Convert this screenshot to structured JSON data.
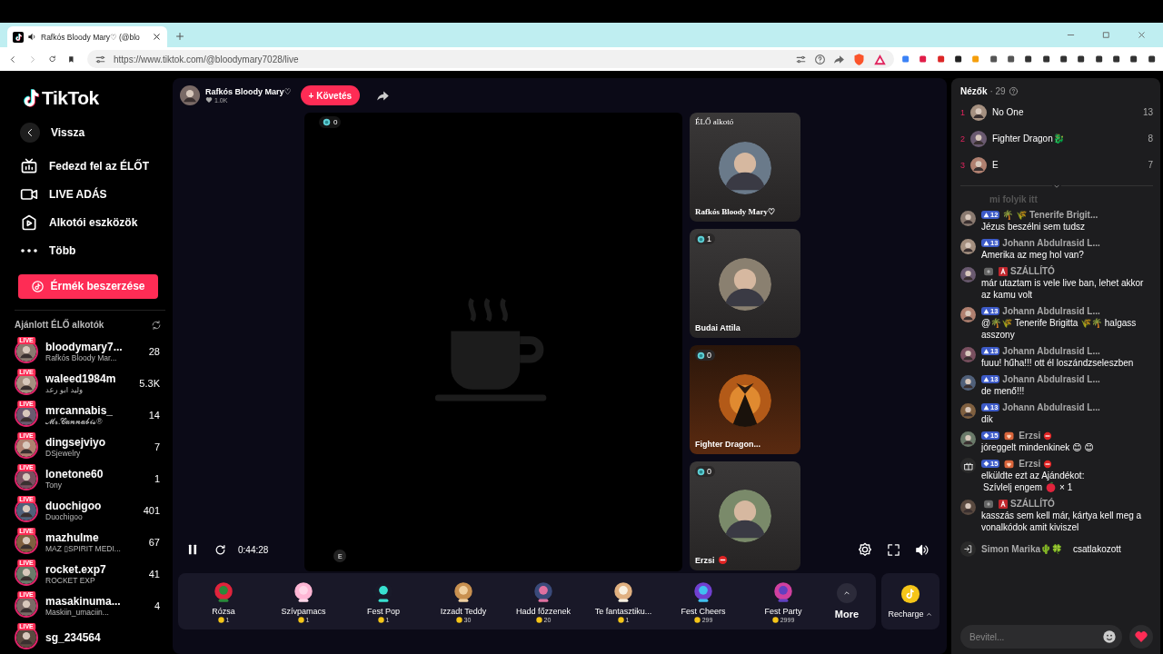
{
  "browser": {
    "tab": {
      "title": "Rafkós Bloody Mary♡ (@blo"
    },
    "url": "https://www.tiktok.com/@bloodymary7028/live"
  },
  "sidebar": {
    "logo": "TikTok",
    "back": "Vissza",
    "nav": [
      {
        "label": "Fedezd fel az ÉLŐT",
        "kind": "tv"
      },
      {
        "label": "LIVE ADÁS",
        "kind": "camera"
      },
      {
        "label": "Alkotói eszközök",
        "kind": "play"
      },
      {
        "label": "Több",
        "kind": "more"
      }
    ],
    "coins_button": "Érmék beszerzése",
    "suggested_title": "Ajánlott ÉLŐ alkotók",
    "creators": [
      {
        "username": "bloodymary7...",
        "name": "Rafkós Bloody Mar...",
        "viewers": "28",
        "badge": "LIVE"
      },
      {
        "username": "waleed1984m",
        "name": "وليد ابو رعد",
        "viewers": "5.3K",
        "badge": "LIVE"
      },
      {
        "username": "mrcannabis_",
        "name": "𝓜𝓻.𝓒𝓪𝓷𝓷𝓪𝓫𝓲𝓼®",
        "viewers": "14",
        "badge": "LIVE"
      },
      {
        "username": "dingsejviyo",
        "name": "DSjewelry",
        "viewers": "7",
        "badge": "LIVE"
      },
      {
        "username": "lonetone60",
        "name": "Tony",
        "viewers": "1",
        "badge": "LIVE"
      },
      {
        "username": "duochigoo",
        "name": "Duochigoo",
        "viewers": "401",
        "badge": "LIVE"
      },
      {
        "username": "mazhulme",
        "name": "MAZ ▯SPIRIT MEDI...",
        "viewers": "67",
        "badge": "LIVE"
      },
      {
        "username": "rocket.exp7",
        "name": "ROCKET EXP",
        "viewers": "41",
        "badge": "LIVE"
      },
      {
        "username": "masakinuma...",
        "name": "Maskiin_umaciin...",
        "viewers": "4",
        "badge": "LIVE"
      },
      {
        "username": "sg_234564",
        "badge": "LIVE"
      }
    ]
  },
  "stream": {
    "host": {
      "name": "Rafkós Bloody Mary♡",
      "likes": "1.0K"
    },
    "follow": "+ Követés",
    "main_viewers": "0",
    "guests": [
      {
        "label": "ÉLŐ alkotó",
        "name": "Rafkós Bloody Mary♡",
        "kind": "host",
        "blocked": false
      },
      {
        "count": "1",
        "name": "Budai Attila",
        "kind": "guest",
        "blocked": false
      },
      {
        "count": "0",
        "name": "Fighter Dragon...",
        "kind": "dragon",
        "blocked": false
      },
      {
        "count": "0",
        "name": "Erzsi",
        "kind": "guest",
        "blocked": true
      }
    ],
    "paused": false,
    "time": "0:44:28",
    "corner_badge": "E"
  },
  "gifts": [
    {
      "name": "Rózsa",
      "price": "1"
    },
    {
      "name": "Szívpamacs",
      "price": "1"
    },
    {
      "name": "Fest Pop",
      "price": "1"
    },
    {
      "name": "Izzadt Teddy",
      "price": "30"
    },
    {
      "name": "Hadd főzzenek",
      "price": "20"
    },
    {
      "name": "Te fantasztiku...",
      "price": "1"
    },
    {
      "name": "Fest Cheers",
      "price": "299"
    },
    {
      "name": "Fest Party",
      "price": "2999"
    }
  ],
  "more": "More",
  "recharge": "Recharge",
  "viewers": {
    "title": "Nézők",
    "count": "· 29",
    "top": [
      {
        "rank": "1",
        "name": "No One",
        "score": "13"
      },
      {
        "rank": "2",
        "name": "Fighter Dragon🐉",
        "score": "8"
      },
      {
        "rank": "3",
        "name": "E",
        "score": "7"
      }
    ]
  },
  "chat": [
    {
      "kind": "faded",
      "text": "mi folyik itt"
    },
    {
      "kind": "message",
      "level": "12",
      "diamond": false,
      "viewer_badge": false,
      "moderator": false,
      "heart_badge": false,
      "blocked": false,
      "user": "🌴 🌾 Tenerife Brigit...",
      "text": "Jézus beszélni sem tudsz"
    },
    {
      "kind": "message",
      "level": "13",
      "diamond": false,
      "viewer_badge": false,
      "moderator": false,
      "heart_badge": false,
      "blocked": false,
      "user": "Johann Abdulrasid L...",
      "text": "Amerika az meg hol van?"
    },
    {
      "kind": "message",
      "viewer_badge": true,
      "moderator": true,
      "heart_badge": false,
      "blocked": false,
      "user": "SZÁLLÍTÓ",
      "text": "már utaztam is vele live ban, lehet akkor az kamu volt"
    },
    {
      "kind": "message",
      "level": "13",
      "diamond": false,
      "viewer_badge": false,
      "moderator": false,
      "heart_badge": false,
      "blocked": false,
      "user": "Johann Abdulrasid L...",
      "text": "@🌴🌾 Tenerife Brigitta 🌾🌴 halgass asszony"
    },
    {
      "kind": "message",
      "level": "13",
      "diamond": false,
      "viewer_badge": false,
      "moderator": false,
      "heart_badge": false,
      "blocked": false,
      "user": "Johann Abdulrasid L...",
      "text": "fuuu! hűha!!! ott él loszándzseleszben"
    },
    {
      "kind": "message",
      "level": "13",
      "diamond": false,
      "viewer_badge": false,
      "moderator": false,
      "heart_badge": false,
      "blocked": false,
      "user": "Johann Abdulrasid L...",
      "text": "de menő!!!"
    },
    {
      "kind": "message",
      "level": "13",
      "diamond": false,
      "viewer_badge": false,
      "moderator": false,
      "heart_badge": false,
      "blocked": false,
      "user": "Johann Abdulrasid L...",
      "text": "dik"
    },
    {
      "kind": "message",
      "level": "15",
      "diamond": true,
      "viewer_badge": false,
      "moderator": false,
      "heart_badge": true,
      "blocked": true,
      "user": "Erzsi",
      "text": "jóreggelt mindenkinek 😊 😊"
    },
    {
      "kind": "gift",
      "level": "15",
      "diamond": true,
      "viewer_badge": false,
      "moderator": false,
      "heart_badge": true,
      "blocked": true,
      "user": "Erzsi",
      "text": "elküldte ezt az Ajándékot:",
      "gift_name": "Szívlelj engem",
      "gift_count": "× 1"
    },
    {
      "kind": "message",
      "viewer_badge": true,
      "moderator": true,
      "heart_badge": false,
      "blocked": false,
      "user": "SZÁLLÍTÓ",
      "text": "kasszás sem kell már, kártya kell meg a vonalkódok amit kiviszel"
    }
  ],
  "join": {
    "user": "Simon Marika🌵🍀",
    "text": "csatlakozott"
  },
  "input": {
    "placeholder": "Bevitel..."
  }
}
